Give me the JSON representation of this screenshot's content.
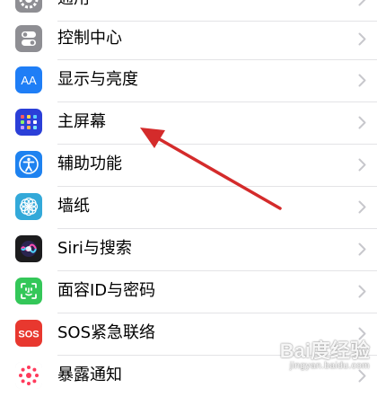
{
  "settings": {
    "rows": [
      {
        "label": "通用",
        "icon": "gear-icon",
        "color": "#8e8e93"
      },
      {
        "label": "控制中心",
        "icon": "control-center-icon",
        "color": "#8e8e93"
      },
      {
        "label": "显示与亮度",
        "icon": "display-brightness-icon",
        "color": "#1f7ef6"
      },
      {
        "label": "主屏幕",
        "icon": "home-screen-icon",
        "color": "#2b3fd8"
      },
      {
        "label": "辅助功能",
        "icon": "accessibility-icon",
        "color": "#1e82f0"
      },
      {
        "label": "墙纸",
        "icon": "wallpaper-icon",
        "color": "#33a9d9"
      },
      {
        "label": "Siri与搜索",
        "icon": "siri-icon",
        "color": "#1c1c1e"
      },
      {
        "label": "面容ID与密码",
        "icon": "face-id-icon",
        "color": "#34c759"
      },
      {
        "label": "SOS紧急联络",
        "icon": "sos-icon",
        "color": "#e8382f"
      },
      {
        "label": "暴露通知",
        "icon": "exposure-notification-icon",
        "color": "#ffffff"
      }
    ]
  },
  "annotation": {
    "color": "#d42b2b"
  },
  "watermark": {
    "main": "Bai度经验",
    "sub": "jingyan.baidu.com"
  }
}
